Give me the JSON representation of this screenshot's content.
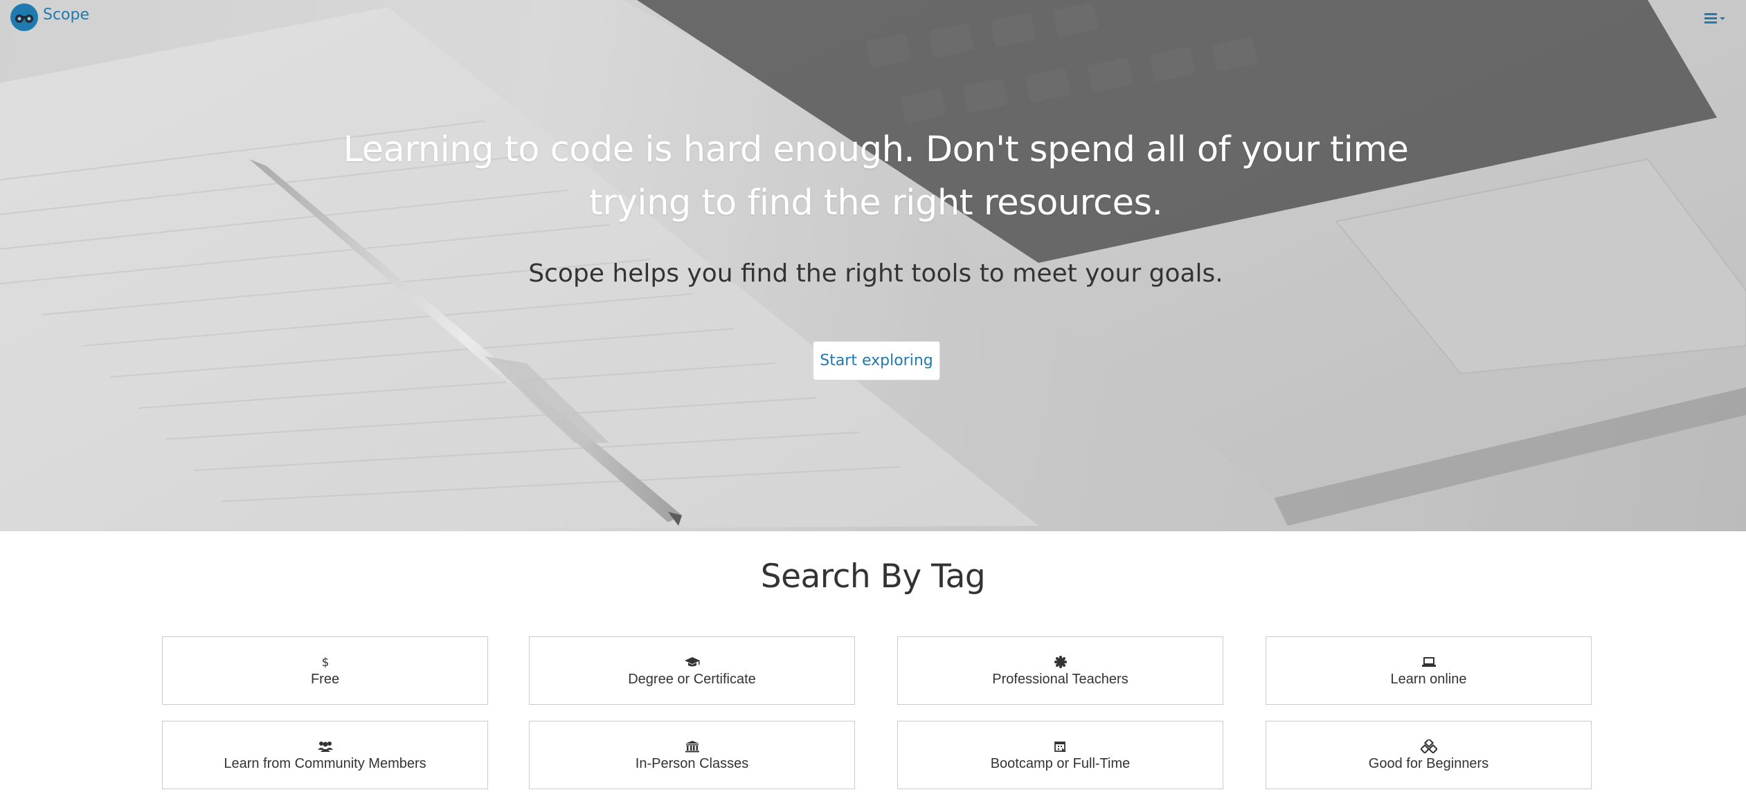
{
  "nav": {
    "brand": "Scope",
    "logo_icon": "binoculars-icon",
    "menu_icon": "hamburger-menu-icon"
  },
  "hero": {
    "headline": "Learning to code is hard enough. Don't spend all of your time trying to find the right resources.",
    "subline": "Scope helps you find the right tools to meet your goals.",
    "cta_label": "Start exploring"
  },
  "tags_section": {
    "title": "Search By Tag",
    "tags": [
      {
        "label": "Free",
        "icon": "dollar-icon"
      },
      {
        "label": "Degree or Certificate",
        "icon": "graduation-cap-icon"
      },
      {
        "label": "Professional Teachers",
        "icon": "certificate-icon"
      },
      {
        "label": "Learn online",
        "icon": "laptop-icon"
      },
      {
        "label": "Learn from Community Members",
        "icon": "users-icon"
      },
      {
        "label": "In-Person Classes",
        "icon": "institution-icon"
      },
      {
        "label": "Bootcamp or Full-Time",
        "icon": "calendar-icon"
      },
      {
        "label": "Good for Beginners",
        "icon": "cubes-icon"
      }
    ]
  },
  "colors": {
    "accent": "#1f7ab0",
    "text": "#333333",
    "hero_text": "#ffffff"
  }
}
